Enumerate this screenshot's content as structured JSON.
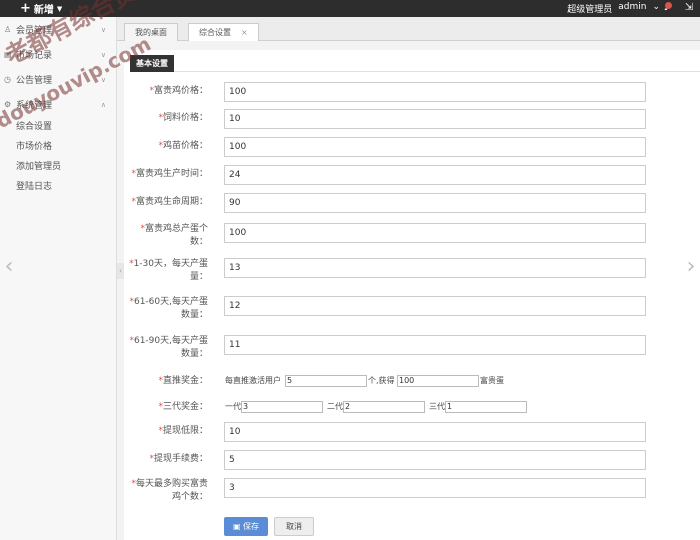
{
  "topbar": {
    "new_label": "新增",
    "role": "超级管理员",
    "user": "admin"
  },
  "sidebar": {
    "items": [
      {
        "label": "会员管理",
        "icon": "user-icon"
      },
      {
        "label": "市场记录",
        "icon": "chart-icon"
      },
      {
        "label": "公告管理",
        "icon": "clock-icon"
      },
      {
        "label": "系统管理",
        "icon": "gear-icon"
      }
    ],
    "subitems": [
      "综合设置",
      "市场价格",
      "添加管理员",
      "登陆日志"
    ]
  },
  "tabs": [
    {
      "label": "我的桌面"
    },
    {
      "label": "综合设置"
    }
  ],
  "section_title": "基本设置",
  "form": {
    "f1": {
      "label": "富贵鸡价格：",
      "value": "100"
    },
    "f2": {
      "label": "饲料价格：",
      "value": "10"
    },
    "f3": {
      "label": "鸡苗价格：",
      "value": "100"
    },
    "f4": {
      "label": "富贵鸡生产时间：",
      "value": "24"
    },
    "f5": {
      "label": "富贵鸡生命周期：",
      "value": "90"
    },
    "f6": {
      "label": "富贵鸡总产蛋个数：",
      "value": "100"
    },
    "f7": {
      "label": "1-30天，每天产蛋量：",
      "value": "13"
    },
    "f8": {
      "label": "61-60天,每天产蛋数量：",
      "value": "12"
    },
    "f9": {
      "label": "61-90天,每天产蛋数量：",
      "value": "11"
    },
    "direct": {
      "label": "直推奖金：",
      "prefix": "每直推激活用户",
      "value1": "5",
      "middle": "个,获得",
      "value2": "100",
      "suffix": "富贵蛋"
    },
    "three": {
      "label": "三代奖金：",
      "g1_label": "一代",
      "g1": "3",
      "g2_label": "二代",
      "g2": "2",
      "g3_label": "三代",
      "g3": "1"
    },
    "f10": {
      "label": "提现低限：",
      "value": "10"
    },
    "f11": {
      "label": "提现手续费：",
      "value": "5"
    },
    "f12": {
      "label": "每天最多购买富贵鸡个数：",
      "value": "3"
    }
  },
  "buttons": {
    "save": "保存",
    "cancel": "取消"
  },
  "watermark": {
    "line1": "老都有综合资源网",
    "line2": "douyouvip.com"
  }
}
